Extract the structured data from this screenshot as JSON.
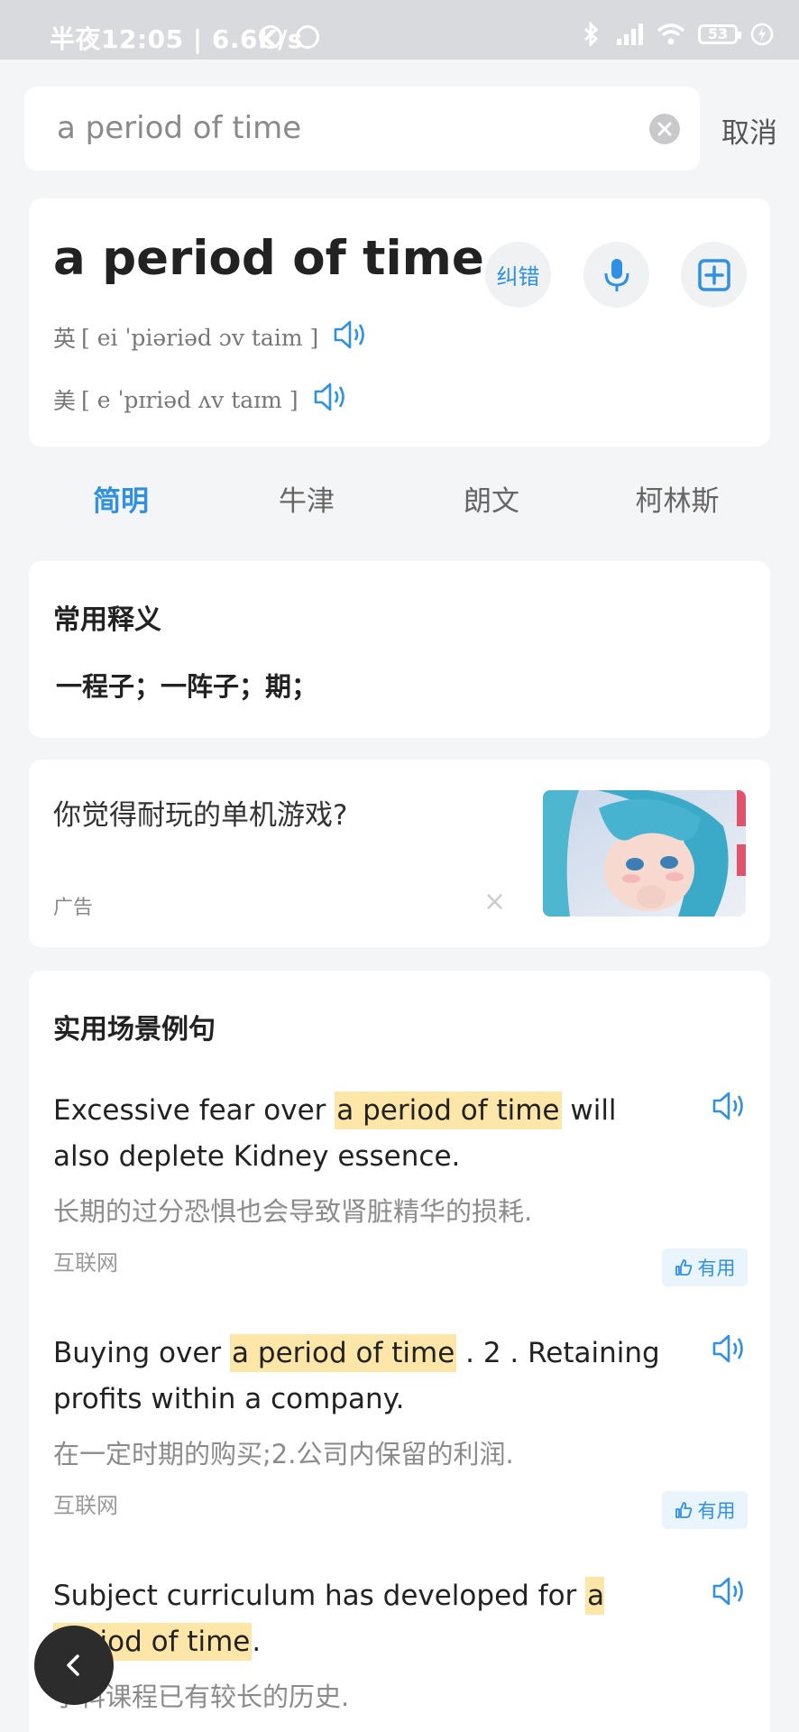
{
  "status_bar": {
    "time": "半夜12:05 | 6.6K/s",
    "battery": "53"
  },
  "search": {
    "query": "a period of time",
    "cancel_label": "取消"
  },
  "word": {
    "headword": "a period of time",
    "correct_label": "纠错",
    "uk_label": "英",
    "uk_phonetic": "[ ei ˈpiəriəd ɔv taim ]",
    "us_label": "美",
    "us_phonetic": "[ e ˈpɪriəd ʌv taɪm ]"
  },
  "tabs": [
    "简明",
    "牛津",
    "朗文",
    "柯林斯"
  ],
  "definitions": {
    "title": "常用释义",
    "text": "一程子；一阵子；期；"
  },
  "ad": {
    "title": "你觉得耐玩的单机游戏?",
    "label": "广告",
    "close": "×"
  },
  "examples": {
    "title": "实用场景例句",
    "useful_label": "有用",
    "items": [
      {
        "before": "Excessive fear over ",
        "highlight": "a period of time",
        "after": " will also deplete Kidney essence.",
        "translation": "长期的过分恐惧也会导致肾脏精华的损耗.",
        "source": "互联网"
      },
      {
        "before": "Buying over ",
        "highlight": "a period of time",
        "after": " . 2 . Retaining profits within a company.",
        "translation": "在一定时期的购买;2.公司内保留的利润.",
        "source": "互联网"
      },
      {
        "before": "Subject curriculum has developed for ",
        "highlight": "a period of time",
        "after": ".",
        "translation": "学科课程已有较长的历史.",
        "source": ""
      }
    ]
  },
  "colors": {
    "accent": "#2f90e4",
    "highlight": "#fde6a8",
    "background": "#f4f5f7"
  }
}
